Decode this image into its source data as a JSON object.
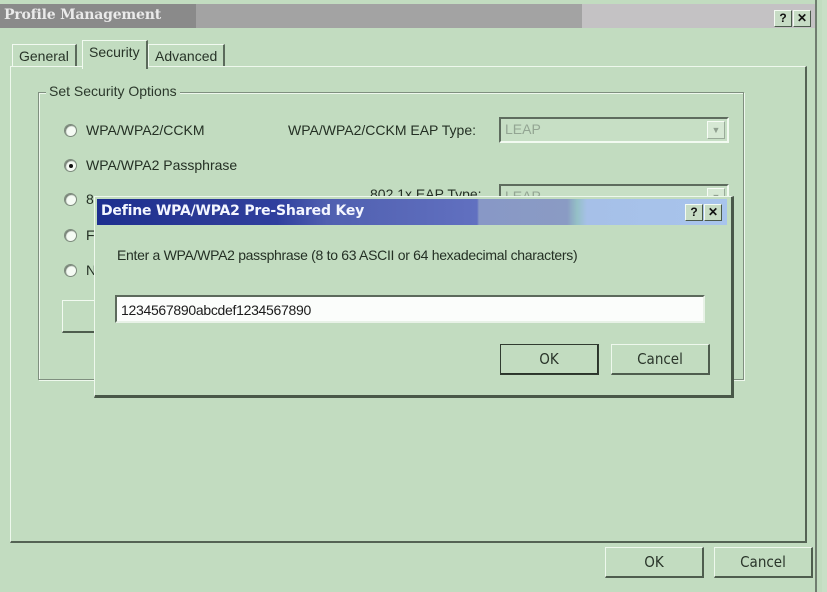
{
  "window": {
    "title": "Profile Management",
    "help_button": "?",
    "close_button": "✕"
  },
  "tabs": [
    {
      "label": "General",
      "active": false
    },
    {
      "label": "Security",
      "active": true
    },
    {
      "label": "Advanced",
      "active": false
    }
  ],
  "security": {
    "group_title": "Set Security Options",
    "options": [
      {
        "label": "WPA/WPA2/CCKM",
        "checked": false
      },
      {
        "label": "WPA/WPA2 Passphrase",
        "checked": true
      },
      {
        "label": "8",
        "checked": false
      },
      {
        "label": "F",
        "checked": false
      },
      {
        "label": "N",
        "checked": false
      }
    ],
    "wpa_eap_label": "WPA/WPA2/CCKM EAP Type:",
    "wpa_eap_value": "LEAP",
    "dot1x_eap_label": "802.1x EAP Type:",
    "dot1x_eap_value": "LEAP"
  },
  "footer": {
    "ok_label": "OK",
    "cancel_label": "Cancel"
  },
  "dialog": {
    "title": "Define WPA/WPA2 Pre-Shared Key",
    "help_button": "?",
    "close_button": "✕",
    "prompt": "Enter a WPA/WPA2 passphrase (8 to 63 ASCII or 64 hexadecimal characters)",
    "passphrase_value": "1234567890abcdef1234567890",
    "ok_label": "OK",
    "cancel_label": "Cancel"
  },
  "icons": {
    "dropdown_arrow": "▼"
  }
}
